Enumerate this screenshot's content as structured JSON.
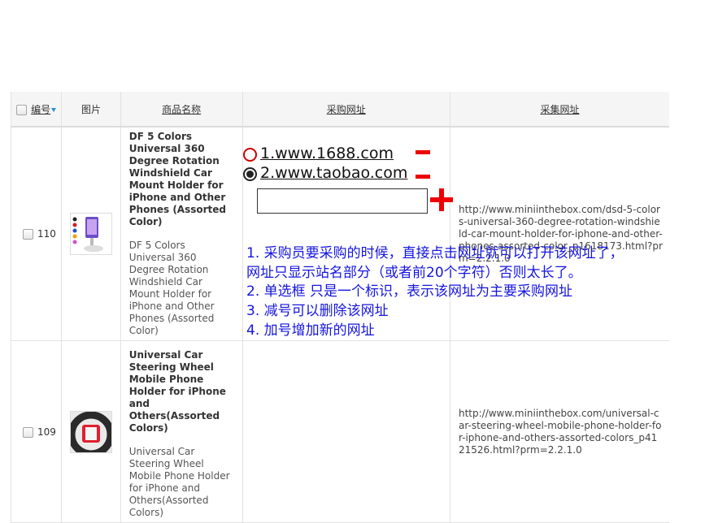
{
  "header": {
    "id": "编号",
    "image": "图片",
    "name": "商品名称",
    "purchase_url": "采购网址",
    "collect_url": "采集网址"
  },
  "rows": [
    {
      "id": "110",
      "title_bold": "DF 5 Colors Universal 360 Degree Rotation Windshield Car Mount Holder for iPhone and Other Phones (Assorted Color)",
      "title_plain": "DF 5 Colors Universal 360 Degree Rotation Windshield Car Mount Holder for iPhone and Other Phones (Assorted Color)",
      "collect_url": "http://www.miniinthebox.com/dsd-5-colors-universal-360-degree-rotation-windshield-car-mount-holder-for-iphone-and-other-phones-assorted-color_p1618173.html?prm=2.2.1.0"
    },
    {
      "id": "109",
      "title_bold": "Universal Car Steering Wheel Mobile Phone Holder for iPhone and Others(Assorted Colors)",
      "title_plain": "Universal Car Steering Wheel Mobile Phone Holder for iPhone and Others(Assorted Colors)",
      "collect_url": "http://www.miniinthebox.com/universal-car-steering-wheel-mobile-phone-holder-for-iphone-and-others-assorted-colors_p4121526.html?prm=2.2.1.0"
    }
  ],
  "purchase": {
    "urls": [
      {
        "label": "1.www.1688.com",
        "selected": false
      },
      {
        "label": "2.www.taobao.com",
        "selected": true
      }
    ],
    "new_url_value": ""
  },
  "notes": [
    "1. 采购员要采购的时候，直接点击网址就可以打开该网址了，",
    "网址只显示站名部分（或者前20个字符）否则太长了。",
    "2. 单选框 只是一个标识，表示该网址为主要采购网址",
    "3. 减号可以删除该网址",
    "4. 加号增加新的网址"
  ],
  "colors": {
    "annotation": "#ee0000",
    "note_text": "#1515e0",
    "sort_arrow": "#2a8fc7"
  }
}
